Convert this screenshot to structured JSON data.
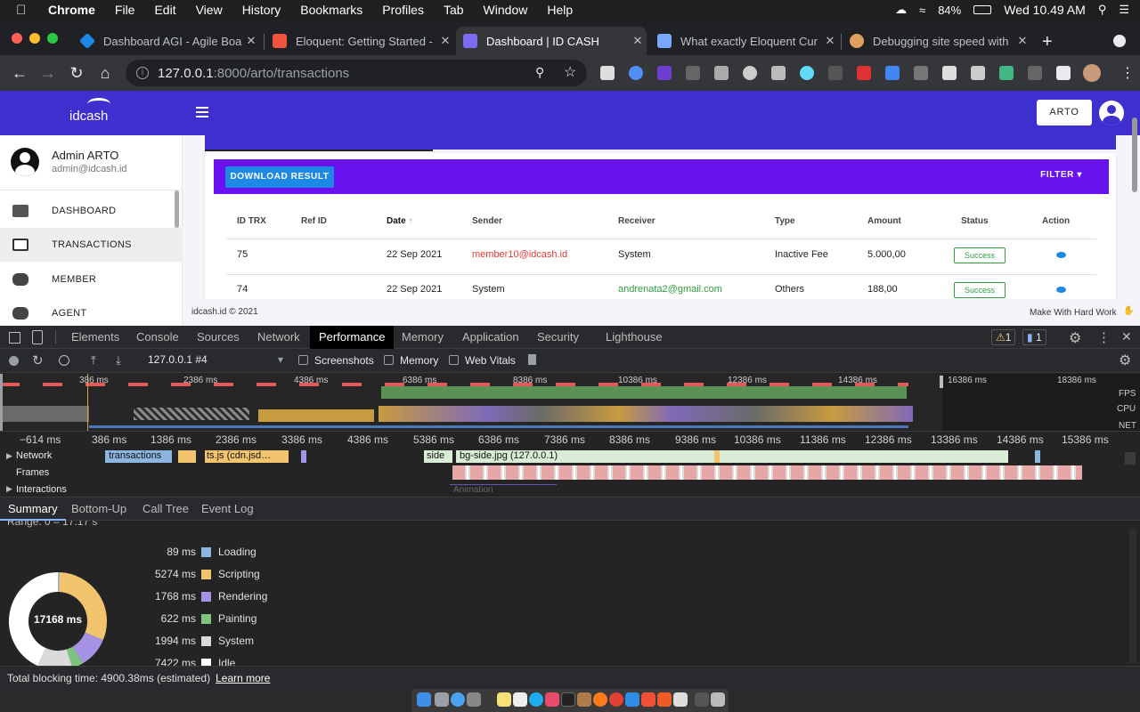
{
  "menubar": {
    "app": "Chrome",
    "items": [
      "File",
      "Edit",
      "View",
      "History",
      "Bookmarks",
      "Profiles",
      "Tab",
      "Window",
      "Help"
    ],
    "battery": "84%",
    "clock": "Wed 10.49 AM"
  },
  "tabs": [
    {
      "title": "Dashboard AGI - Agile Boa",
      "favicon": "blue-diamond-icon",
      "color": "#1e88e5"
    },
    {
      "title": "Eloquent: Getting Started -",
      "favicon": "laravel-icon",
      "color": "#f05340"
    },
    {
      "title": "Dashboard | ID CASH",
      "favicon": "idcash-icon",
      "color": "#7c6cf0"
    },
    {
      "title": "What exactly Eloquent Cur",
      "favicon": "paper-plane-icon",
      "color": "#7aa7ff"
    },
    {
      "title": "Debugging site speed with",
      "favicon": "bear-icon",
      "color": "#e0a060"
    }
  ],
  "omnibox": {
    "host": "127.0.0.1",
    "path": ":8000/arto/transactions"
  },
  "app": {
    "brand": "idcash",
    "user_button": "ARTO",
    "user": {
      "name": "Admin ARTO",
      "email": "admin@idcash.id"
    },
    "nav": [
      "DASHBOARD",
      "TRANSACTIONS",
      "MEMBER",
      "AGENT"
    ],
    "active_nav": "TRANSACTIONS",
    "download_label": "DOWNLOAD RESULT",
    "filter_label": "FILTER",
    "columns": [
      "ID TRX",
      "Ref ID",
      "Date",
      "Sender",
      "Receiver",
      "Type",
      "Amount",
      "Status",
      "Action"
    ],
    "rows": [
      {
        "id": "75",
        "ref": "",
        "date": "22 Sep 2021",
        "sender": "member10@idcash.id",
        "receiver": "System",
        "type": "Inactive Fee",
        "amount": "5.000,00",
        "status": "Success"
      },
      {
        "id": "74",
        "ref": "",
        "date": "22 Sep 2021",
        "sender": "System",
        "receiver": "andrenata2@gmail.com",
        "type": "Others",
        "amount": "188,00",
        "status": "Success"
      }
    ],
    "footer_left": "idcash.id © 2021",
    "footer_right": "Make With Hard Work"
  },
  "devtools": {
    "tabs": [
      "Elements",
      "Console",
      "Sources",
      "Network",
      "Performance",
      "Memory",
      "Application",
      "Security",
      "Lighthouse"
    ],
    "active_tab": "Performance",
    "warnings": "1",
    "messages": "1",
    "profile": "127.0.0.1 #4",
    "checkboxes": [
      "Screenshots",
      "Memory",
      "Web Vitals"
    ],
    "overview_ticks": [
      "386 ms",
      "2386 ms",
      "4386 ms",
      "6386 ms",
      "8386 ms",
      "10386 ms",
      "12386 ms",
      "14386 ms",
      "16386 ms",
      "18386 ms"
    ],
    "overview_lanes": [
      "FPS",
      "CPU",
      "NET"
    ],
    "ruler_ticks": [
      "−614 ms",
      "386 ms",
      "1386 ms",
      "2386 ms",
      "3386 ms",
      "4386 ms",
      "5386 ms",
      "6386 ms",
      "7386 ms",
      "8386 ms",
      "9386 ms",
      "10386 ms",
      "11386 ms",
      "12386 ms",
      "13386 ms",
      "14386 ms",
      "15386 ms"
    ],
    "tracks": [
      "Network",
      "Frames",
      "Interactions"
    ],
    "net_labels": [
      "transactions",
      "ts.js (cdn.jsd…",
      "side",
      "bg-side.jpg (127.0.0.1)"
    ],
    "anim_label": "Animation",
    "summary_tabs": [
      "Summary",
      "Bottom-Up",
      "Call Tree",
      "Event Log"
    ],
    "range": "Range: 0 – 17.17 s",
    "total": "17168 ms",
    "breakdown": [
      {
        "ms": "89 ms",
        "label": "Loading",
        "value": 89,
        "color": "#8cb5e0"
      },
      {
        "ms": "5274 ms",
        "label": "Scripting",
        "value": 5274,
        "color": "#f2c46e"
      },
      {
        "ms": "1768 ms",
        "label": "Rendering",
        "value": 1768,
        "color": "#a793e5"
      },
      {
        "ms": "622 ms",
        "label": "Painting",
        "value": 622,
        "color": "#7fc47e"
      },
      {
        "ms": "1994 ms",
        "label": "System",
        "value": 1994,
        "color": "#dadada"
      },
      {
        "ms": "7422 ms",
        "label": "Idle",
        "value": 7422,
        "color": "#ffffff"
      }
    ],
    "blocking": "Total blocking time: 4900.38ms (estimated)",
    "learn_more": "Learn more"
  }
}
